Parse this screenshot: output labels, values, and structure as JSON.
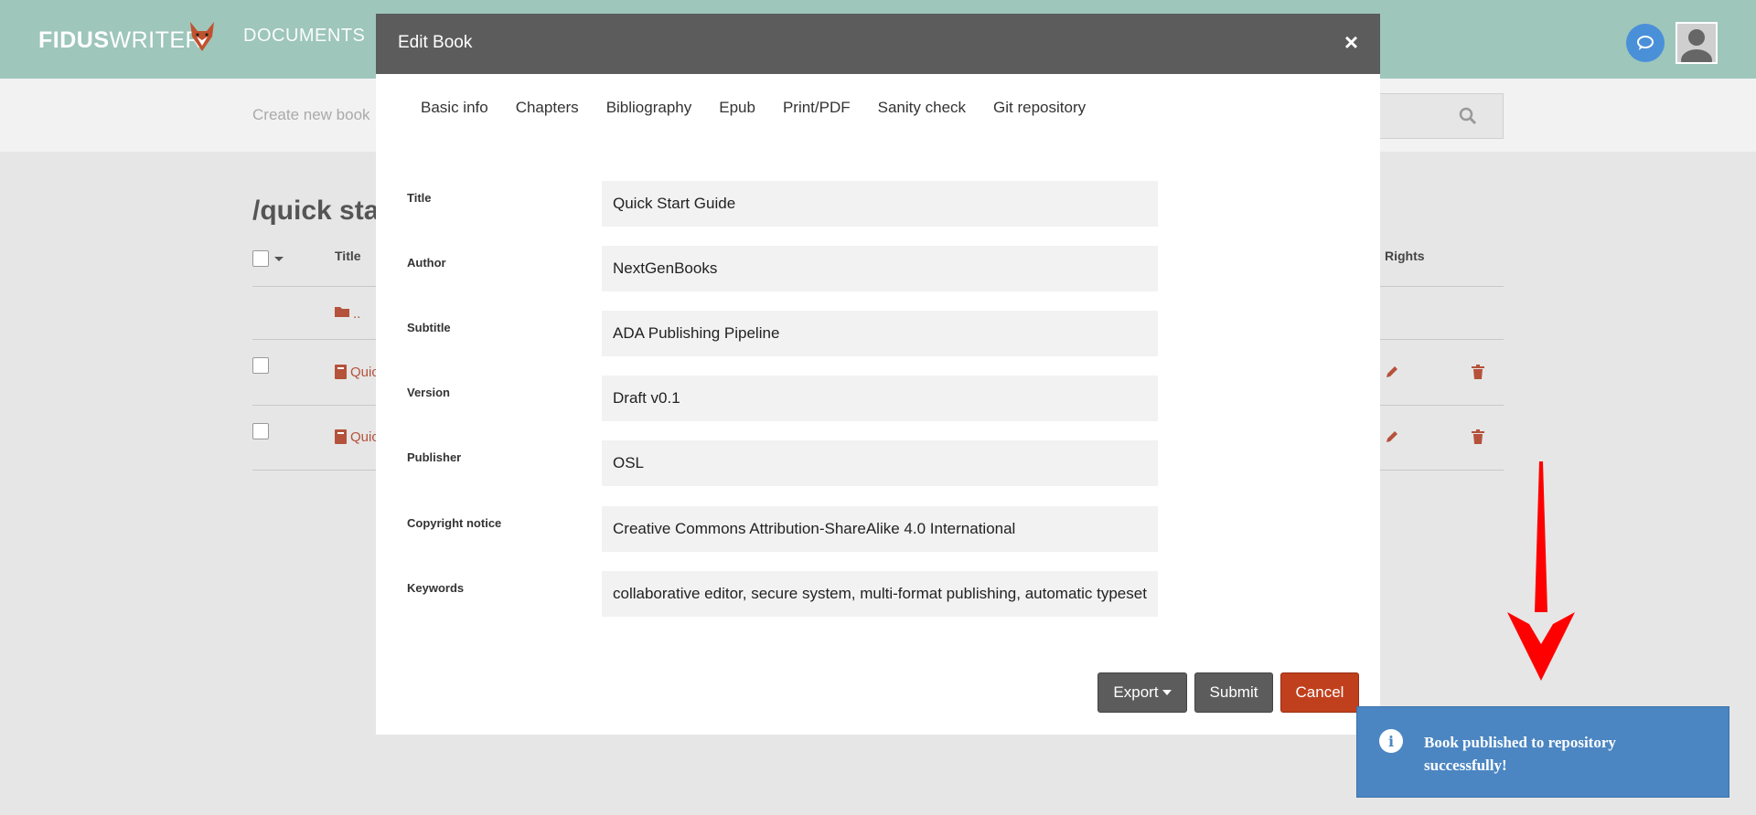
{
  "header": {
    "logo_bold": "FIDUS",
    "logo_light": "WRITER",
    "nav_documents": "DOCUMENTS"
  },
  "subbar": {
    "create_new": "Create new book"
  },
  "background": {
    "path": "/quick sta",
    "col_title": "Title",
    "col_rights": "Rights",
    "parent_folder": "..",
    "row1_title": "Quic",
    "row2_title": "Quic"
  },
  "modal": {
    "title": "Edit Book",
    "close": "×",
    "tabs": [
      "Basic info",
      "Chapters",
      "Bibliography",
      "Epub",
      "Print/PDF",
      "Sanity check",
      "Git repository"
    ],
    "fields": [
      {
        "label": "Title",
        "value": "Quick Start Guide"
      },
      {
        "label": "Author",
        "value": "NextGenBooks"
      },
      {
        "label": "Subtitle",
        "value": "ADA Publishing Pipeline"
      },
      {
        "label": "Version",
        "value": "Draft v0.1"
      },
      {
        "label": "Publisher",
        "value": "OSL"
      },
      {
        "label": "Copyright notice",
        "value": "Creative Commons Attribution-ShareAlike 4.0 International"
      },
      {
        "label": "Keywords",
        "value": "collaborative editor, secure system, multi-format publishing, automatic typesetting"
      }
    ],
    "buttons": {
      "export": "Export",
      "submit": "Submit",
      "cancel": "Cancel"
    }
  },
  "toast": {
    "icon": "i",
    "message": "Book published to repository successfully!"
  },
  "colors": {
    "header_bg": "#9ec6bb",
    "modal_head": "#5c5c5c",
    "cancel": "#c0401d",
    "toast": "#4b86c2",
    "link": "#b5523b",
    "arrow": "#ff0000"
  }
}
